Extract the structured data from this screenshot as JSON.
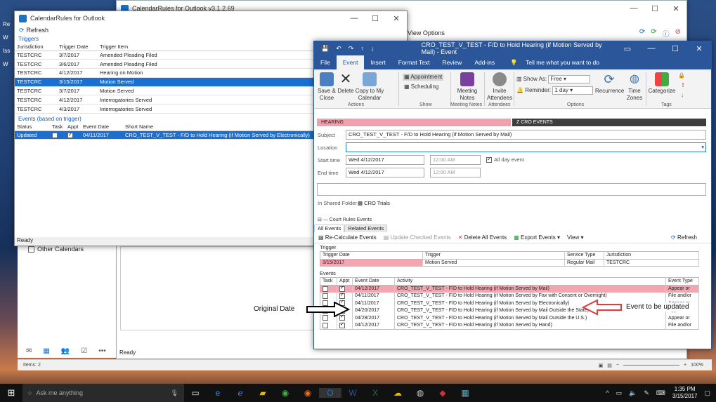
{
  "desktop": {
    "labels": [
      "Re",
      "W",
      "Iss",
      "W"
    ]
  },
  "back_window": {
    "title": "CalendarRules for Outlook v3.1.2.69",
    "view_options": "View Options",
    "other_calendars": "Other Calendars",
    "status": "Ready"
  },
  "calendarrules": {
    "title": "CalendarRules for Outlook",
    "refresh": "Refresh",
    "triggers_label": "Triggers",
    "trigger_headers": [
      "Jurisdiction",
      "Trigger Date",
      "Trigger Item"
    ],
    "triggers": [
      [
        "TESTCRC",
        "3/7/2017",
        "Amended Pleading Filed"
      ],
      [
        "TESTCRC",
        "3/6/2017",
        "Amended Pleading Filed"
      ],
      [
        "TESTCRC",
        "4/12/2017",
        "Hearing on Motion"
      ],
      [
        "TESTCRC",
        "3/15/2017",
        "Motion Served"
      ],
      [
        "TESTCRC",
        "3/7/2017",
        "Motion Served"
      ],
      [
        "TESTCRC",
        "4/12/2017",
        "Interrogatories Served"
      ],
      [
        "TESTCRC",
        "4/3/2017",
        "Interrogatories Served"
      ]
    ],
    "selected_trigger": 3,
    "events_label": "Events (based on trigger)",
    "event_headers": [
      "Status",
      "Task",
      "Appt",
      "Event Date",
      "Short Name"
    ],
    "events": [
      [
        "Updated",
        "",
        "",
        "04/11/2017",
        "CRO_TEST_V_TEST - F/D to Hold Hearing (if Motion Served by Electronically)"
      ]
    ],
    "status": "Ready"
  },
  "event_window": {
    "title": "CRO_TEST_V_TEST - F/D to Hold Hearing (if Motion Served by Mail)  -  Event",
    "tabs": [
      "File",
      "Event",
      "Insert",
      "Format Text",
      "Review",
      "Add-ins"
    ],
    "active_tab": "Event",
    "tell_me": "Tell me what you want to do",
    "ribbon": {
      "save_close": "Save & Close",
      "delete": "Delete",
      "copy_to_calendar": "Copy to My Calendar",
      "actions": "Actions",
      "appointment": "Appointment",
      "scheduling": "Scheduling",
      "show": "Show",
      "meeting_notes": "Meeting Notes",
      "meeting_notes_grp": "Meeting Notes",
      "invite_attendees": "Invite Attendees",
      "attendees": "Attendees",
      "show_as": "Show As:",
      "show_as_value": "Free",
      "reminder": "Reminder:",
      "reminder_value": "1 day",
      "recurrence": "Recurrence",
      "time_zones": "Time Zones",
      "options": "Options",
      "categorize": "Categorize",
      "tags": "Tags"
    },
    "category_hearing": "HEARING",
    "category_cro": "Z CRO EVENTS",
    "subject_label": "Subject",
    "subject": "CRO_TEST_V_TEST - F/D to Hold Hearing (if Motion Served by Mail)",
    "location_label": "Location",
    "start_label": "Start time",
    "start_date": "Wed 4/12/2017",
    "start_time": "12:00 AM",
    "all_day": "All day event",
    "end_label": "End time",
    "end_date": "Wed 4/12/2017",
    "end_time": "12:00 AM",
    "shared_folder_label": "In Shared Folder",
    "shared_folder": "CRO Trials",
    "court_rules_label": "Court Rules Events",
    "court_tabs": [
      "All Events",
      "Related Events"
    ],
    "toolbar": {
      "recalc": "Re-Calculate Events",
      "update_checked": "Update Checked Events",
      "delete_all": "Delete All Events",
      "export": "Export Events",
      "view": "View",
      "refresh": "Refresh"
    },
    "trigger_label": "Trigger",
    "trigger_headers": [
      "Trigger Date",
      "Trigger",
      "Service Type",
      "Jurisdiction"
    ],
    "trigger_row": [
      "3/15/2017",
      "Motion Served",
      "Regular Mail",
      "TESTCRC"
    ],
    "events_label": "Events",
    "event_headers": [
      "Task",
      "Appt",
      "Event Date",
      "Activity",
      "Event Type"
    ],
    "events": [
      [
        "04/12/2017",
        "CRO_TEST_V_TEST - F/D to Hold Hearing (if Motion Served by Mail)",
        "Appear or"
      ],
      [
        "04/11/2017",
        "CRO_TEST_V_TEST - F/D to Hold Hearing (if Motion Served by Fax with Consent or Overnight)",
        "File and/or"
      ],
      [
        "04/11/2017",
        "CRO_TEST_V_TEST - F/D to Hold Hearing (if Motion Served by Electronically)",
        "Appear or"
      ],
      [
        "04/20/2017",
        "CRO_TEST_V_TEST - F/D to Hold Hearing (if Motion Served by Mail Outside the State)",
        "Appear or"
      ],
      [
        "04/28/2017",
        "CRO_TEST_V_TEST - F/D to Hold Hearing (if Motion Served by Mail Outside the U.S.)",
        "Appear or"
      ],
      [
        "04/12/2017",
        "CRO_TEST_V_TEST - F/D to Hold Hearing (if Motion Served by Hand)",
        "File and/or"
      ]
    ]
  },
  "annotations": {
    "original_date": "Original Date",
    "event_updated": "Event to be updated"
  },
  "bottom_status": {
    "items": "Items: 2",
    "zoom": "100%"
  },
  "taskbar": {
    "search": "Ask me anything",
    "time": "1:35 PM",
    "date": "3/15/2017"
  }
}
